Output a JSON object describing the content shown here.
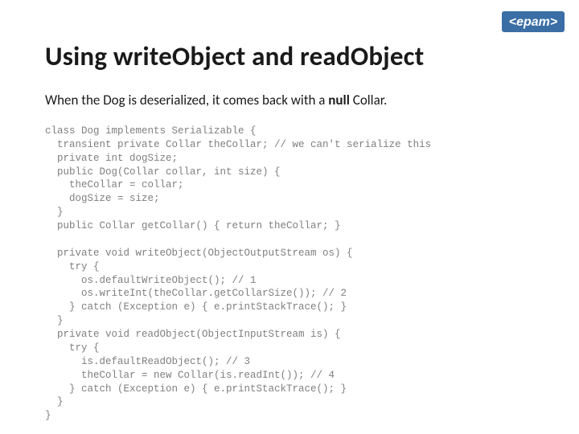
{
  "logo": {
    "text": "<epam>"
  },
  "title": "Using writeObject and readObject",
  "subtitle_pre": "When the Dog is deserialized, it comes back with a ",
  "subtitle_bold": "null",
  "subtitle_post": " Collar.",
  "code": "class Dog implements Serializable {\n  transient private Collar theCollar; // we can't serialize this\n  private int dogSize;\n  public Dog(Collar collar, int size) {\n    theCollar = collar;\n    dogSize = size;\n  }\n  public Collar getCollar() { return theCollar; }\n\n  private void writeObject(ObjectOutputStream os) {\n    try {\n      os.defaultWriteObject(); // 1\n      os.writeInt(theCollar.getCollarSize()); // 2\n    } catch (Exception e) { e.printStackTrace(); }\n  }\n  private void readObject(ObjectInputStream is) {\n    try {\n      is.defaultReadObject(); // 3\n      theCollar = new Collar(is.readInt()); // 4\n    } catch (Exception e) { e.printStackTrace(); }\n  }\n}"
}
